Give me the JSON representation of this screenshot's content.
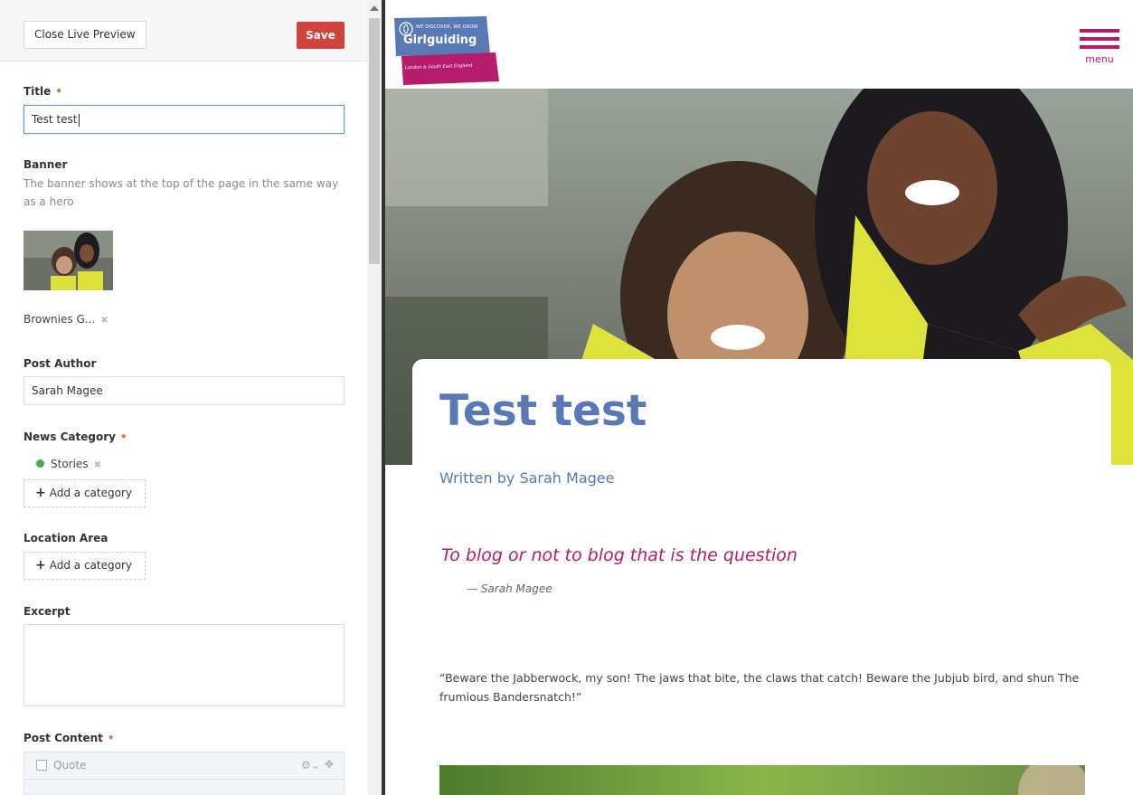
{
  "editor": {
    "close_label": "Close Live Preview",
    "save_label": "Save",
    "title_label": "Title",
    "title_value": "Test test",
    "banner_label": "Banner",
    "banner_desc": "The banner shows at the top of the page in the same way as a hero",
    "banner_file": "Brownies G...",
    "author_label": "Post Author",
    "author_value": "Sarah Magee",
    "category_label": "News Category",
    "category_tag": "Stories",
    "add_category": "Add a category",
    "location_label": "Location Area",
    "add_location": "Add a category",
    "excerpt_label": "Excerpt",
    "content_label": "Post Content",
    "content_block_label": "Quote",
    "required_mark": "•"
  },
  "site": {
    "logo_tagline": "WE DISCOVER, WE GROW",
    "logo_name": "Girlguiding",
    "logo_region": "London & South East England",
    "menu_label": "menu",
    "post_title": "Test test",
    "byline": "Written by Sarah Magee",
    "quote": "To blog or not to blog that is the question",
    "quote_author": "— Sarah Magee",
    "body": "“Beware the Jabberwock, my son! The jaws that bite, the claws that catch! Beware the Jubjub bird, and shun The frumious Bandersnatch!”"
  },
  "colors": {
    "save": "#d0453a",
    "required": "#e8742e",
    "brand_blue": "#5a78b6",
    "brand_magenta": "#b51c6c",
    "category_dot": "#3ab34a"
  },
  "icons": {
    "remove": "close-icon",
    "add": "plus-icon",
    "settings": "gear-icon",
    "move": "move-icon",
    "menu": "hamburger-icon"
  }
}
